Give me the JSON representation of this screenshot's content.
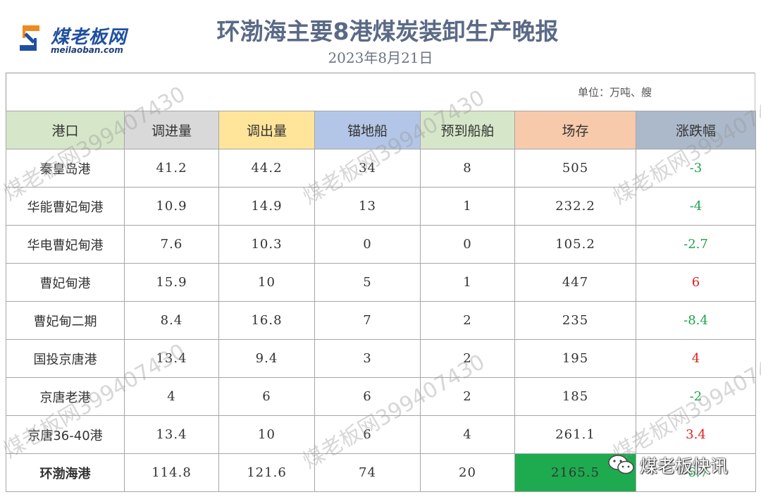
{
  "logo": {
    "name": "煤老板网",
    "url": "meilaoban.com"
  },
  "title": "环渤海主要8港煤炭装卸生产晚报",
  "date": "2023年8月21日",
  "unit": "单位：万吨、艘",
  "headers": [
    "港口",
    "调进量",
    "调出量",
    "锚地船",
    "预到船舶",
    "场存",
    "涨跌幅"
  ],
  "rows": [
    {
      "port": "秦皇岛港",
      "in": "41.2",
      "out": "44.2",
      "anchor": "34",
      "arrive": "8",
      "stock": "505",
      "change": "-3",
      "dir": "down"
    },
    {
      "port": "华能曹妃甸港",
      "in": "10.9",
      "out": "14.9",
      "anchor": "13",
      "arrive": "1",
      "stock": "232.2",
      "change": "-4",
      "dir": "down"
    },
    {
      "port": "华电曹妃甸港",
      "in": "7.6",
      "out": "10.3",
      "anchor": "0",
      "arrive": "0",
      "stock": "105.2",
      "change": "-2.7",
      "dir": "down"
    },
    {
      "port": "曹妃甸港",
      "in": "15.9",
      "out": "10",
      "anchor": "5",
      "arrive": "1",
      "stock": "447",
      "change": "6",
      "dir": "up"
    },
    {
      "port": "曹妃甸二期",
      "in": "8.4",
      "out": "16.8",
      "anchor": "7",
      "arrive": "2",
      "stock": "235",
      "change": "-8.4",
      "dir": "down"
    },
    {
      "port": "国投京唐港",
      "in": "13.4",
      "out": "9.4",
      "anchor": "3",
      "arrive": "2",
      "stock": "195",
      "change": "4",
      "dir": "up"
    },
    {
      "port": "京唐老港",
      "in": "4",
      "out": "6",
      "anchor": "6",
      "arrive": "2",
      "stock": "185",
      "change": "-2",
      "dir": "down"
    },
    {
      "port": "京唐36-40港",
      "in": "13.4",
      "out": "10",
      "anchor": "6",
      "arrive": "4",
      "stock": "261.1",
      "change": "3.4",
      "dir": "up"
    }
  ],
  "total": {
    "port": "环渤海港",
    "in": "114.8",
    "out": "121.6",
    "anchor": "74",
    "arrive": "20",
    "stock": "2165.5",
    "change": "-6.7",
    "dir": "down"
  },
  "watermark": {
    "brand": "煤老板网",
    "number": "399407430"
  },
  "wechat": {
    "label": "煤老板快讯"
  },
  "colors": {
    "up": "#e02020",
    "down": "#1fa34a",
    "stock_highlight": "#1eab4f"
  }
}
